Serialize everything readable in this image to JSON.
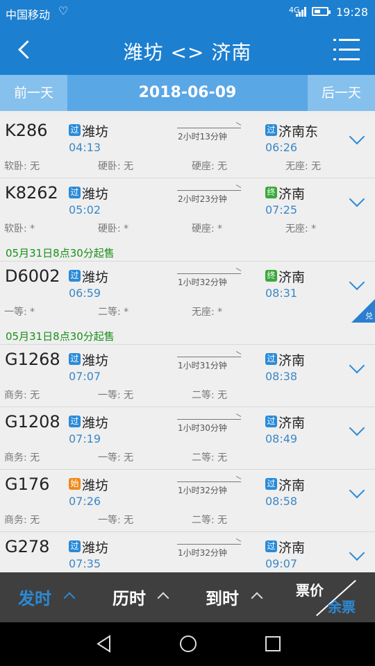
{
  "status": {
    "carrier": "中国移动",
    "network": "4G",
    "time": "19:28"
  },
  "header": {
    "title": "潍坊 <> 济南"
  },
  "datebar": {
    "prev": "前一天",
    "date": "2018-06-09",
    "next": "后一天"
  },
  "trains": [
    {
      "num": "K286",
      "from_tag": "过",
      "from": "潍坊",
      "dep": "04:13",
      "dur": "2小时13分钟",
      "to_tag": "过",
      "to": "济南东",
      "arr": "06:26",
      "seats": [
        "软卧: 无",
        "硬卧: 无",
        "硬座: 无",
        "无座: 无"
      ],
      "sale": "",
      "corner": ""
    },
    {
      "num": "K8262",
      "from_tag": "过",
      "from": "潍坊",
      "dep": "05:02",
      "dur": "2小时23分钟",
      "to_tag": "终",
      "to": "济南",
      "arr": "07:25",
      "seats": [
        "软卧: *",
        "硬卧: *",
        "硬座: *",
        "无座: *"
      ],
      "sale": "05月31日8点30分起售",
      "corner": ""
    },
    {
      "num": "D6002",
      "from_tag": "过",
      "from": "潍坊",
      "dep": "06:59",
      "dur": "1小时32分钟",
      "to_tag": "终",
      "to": "济南",
      "arr": "08:31",
      "seats": [
        "一等: *",
        "二等: *",
        "无座: *"
      ],
      "sale": "05月31日8点30分起售",
      "corner": "兑"
    },
    {
      "num": "G1268",
      "from_tag": "过",
      "from": "潍坊",
      "dep": "07:07",
      "dur": "1小时31分钟",
      "to_tag": "过",
      "to": "济南",
      "arr": "08:38",
      "seats": [
        "商务: 无",
        "一等: 无",
        "二等: 无"
      ],
      "sale": "",
      "corner": ""
    },
    {
      "num": "G1208",
      "from_tag": "过",
      "from": "潍坊",
      "dep": "07:19",
      "dur": "1小时30分钟",
      "to_tag": "过",
      "to": "济南",
      "arr": "08:49",
      "seats": [
        "商务: 无",
        "一等: 无",
        "二等: 无"
      ],
      "sale": "",
      "corner": ""
    },
    {
      "num": "G176",
      "from_tag": "始",
      "from": "潍坊",
      "dep": "07:26",
      "dur": "1小时32分钟",
      "to_tag": "过",
      "to": "济南",
      "arr": "08:58",
      "seats": [
        "商务: 无",
        "一等: 无",
        "二等: 无"
      ],
      "sale": "",
      "corner": ""
    },
    {
      "num": "G278",
      "from_tag": "过",
      "from": "潍坊",
      "dep": "07:35",
      "dur": "1小时32分钟",
      "to_tag": "过",
      "to": "济南",
      "arr": "09:07",
      "seats": [],
      "sale": "",
      "corner": ""
    }
  ],
  "tag_colors": {
    "过": "#2a8bd8",
    "终": "#3aa83a",
    "始": "#f08a1c"
  },
  "bottom": {
    "depart": "发时",
    "duration": "历时",
    "arrive": "到时",
    "price": "票价",
    "remain": "余票"
  },
  "icons": {
    "back": "chevron-left-icon",
    "menu": "menu-list-icon",
    "expand": "chevron-down-icon"
  }
}
